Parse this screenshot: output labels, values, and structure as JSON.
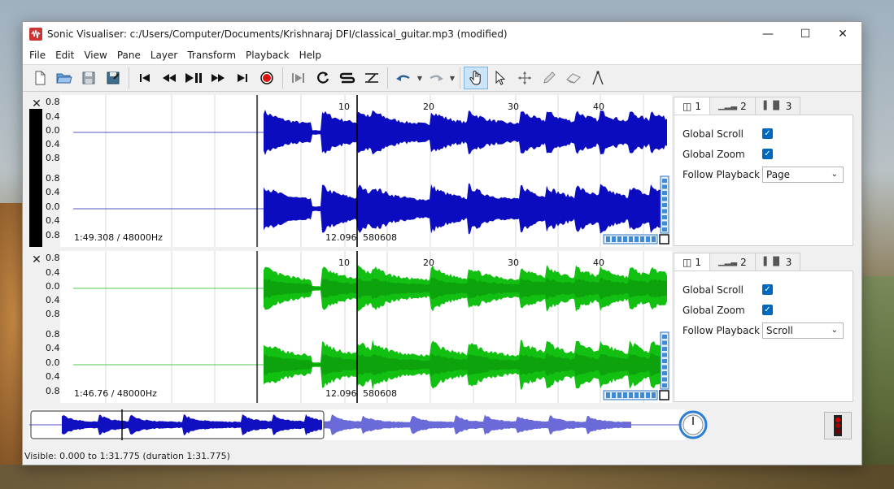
{
  "window": {
    "title": "Sonic Visualiser: c:/Users/Computer/Documents/Krishnaraj DFI/classical_guitar.mp3 (modified)",
    "controls": {
      "minimize": "—",
      "maximize": "☐",
      "close": "✕"
    }
  },
  "menu": [
    "File",
    "Edit",
    "View",
    "Pane",
    "Layer",
    "Transform",
    "Playback",
    "Help"
  ],
  "panes": [
    {
      "close": "✕",
      "y_ticks_top": [
        "0.8",
        "0.4",
        "0.0",
        "0.4",
        "0.8"
      ],
      "y_ticks_bottom": [
        "0.8",
        "0.4",
        "0.0",
        "0.4",
        "0.8"
      ],
      "time_ticks": [
        "10",
        "20",
        "30",
        "40"
      ],
      "position_label": "1:49.308 / 48000Hz",
      "cursor_time": "12.096",
      "cursor_frame": "580608",
      "wave_color": "#0b0bbf",
      "line_color": "#5050c8",
      "tabs": [
        "1",
        "2",
        "3"
      ],
      "props": {
        "scroll_label": "Global Scroll",
        "zoom_label": "Global Zoom",
        "follow_label": "Follow Playback",
        "follow_value": "Page",
        "scroll_checked": "✓",
        "zoom_checked": "✓"
      }
    },
    {
      "close": "✕",
      "y_ticks_top": [
        "0.8",
        "0.4",
        "0.0",
        "0.4",
        "0.8"
      ],
      "y_ticks_bottom": [
        "0.8",
        "0.4",
        "0.0",
        "0.4",
        "0.8"
      ],
      "time_ticks": [
        "10",
        "20",
        "30",
        "40"
      ],
      "position_label": "1:46.76 / 48000Hz",
      "cursor_time": "12.096",
      "cursor_frame": "580608",
      "wave_color": "#12c012",
      "line_color": "#50c850",
      "tabs": [
        "1",
        "2",
        "3"
      ],
      "props": {
        "scroll_label": "Global Scroll",
        "zoom_label": "Global Zoom",
        "follow_label": "Follow Playback",
        "follow_value": "Scroll",
        "scroll_checked": "✓",
        "zoom_checked": "✓"
      }
    }
  ],
  "overview": {
    "wave_color": "#1010c0",
    "faded_color": "#6a6ad8"
  },
  "status": "Visible: 0.000 to 1:31.775 (duration 1:31.775)"
}
